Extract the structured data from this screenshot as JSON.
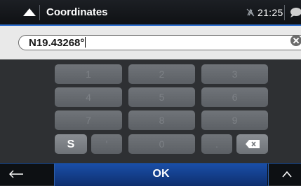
{
  "header": {
    "title": "Coordinates",
    "time": "21:25",
    "icons": [
      "navigation-arrow-icon",
      "gps-off-icon",
      "message-bubble-icon"
    ]
  },
  "input": {
    "value": "N19.43268°"
  },
  "keypad": {
    "rows": [
      [
        "1",
        "2",
        "3"
      ],
      [
        "4",
        "5",
        "6"
      ],
      [
        "7",
        "8",
        "9"
      ]
    ],
    "bottom_row": {
      "hemisphere_key": "S",
      "apostrophe_key": "'",
      "zero_key": "0",
      "dot_key": "."
    },
    "enabled_keys": [
      "S",
      "backspace"
    ]
  },
  "footer": {
    "ok_label": "OK"
  },
  "colors": {
    "accent_blue": "#2f6fd0",
    "ok_button": "#1a4fa8",
    "key_disabled": "#62666b",
    "key_enabled": "#7f8388"
  }
}
